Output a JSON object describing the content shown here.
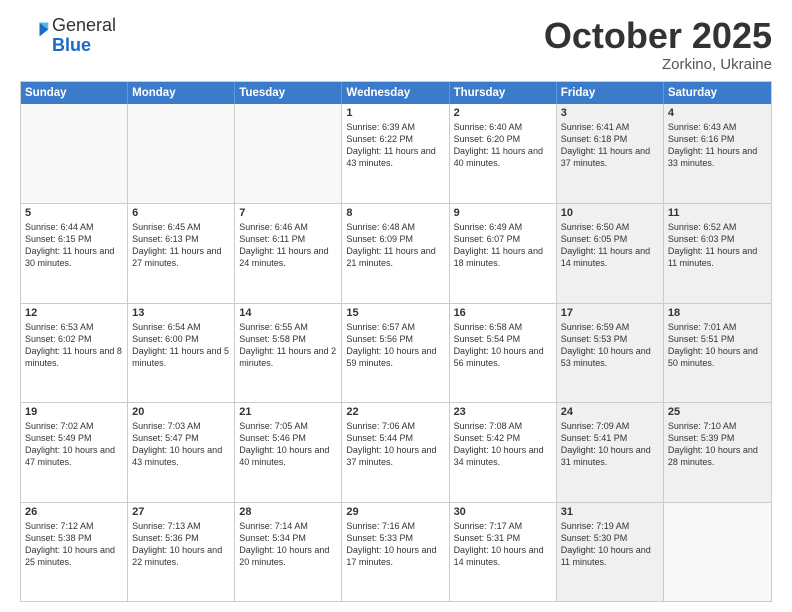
{
  "header": {
    "logo": {
      "general": "General",
      "blue": "Blue"
    },
    "month": "October 2025",
    "location": "Zorkino, Ukraine"
  },
  "weekdays": [
    "Sunday",
    "Monday",
    "Tuesday",
    "Wednesday",
    "Thursday",
    "Friday",
    "Saturday"
  ],
  "rows": [
    [
      {
        "day": "",
        "info": "",
        "bg": "empty"
      },
      {
        "day": "",
        "info": "",
        "bg": "empty"
      },
      {
        "day": "",
        "info": "",
        "bg": "empty"
      },
      {
        "day": "1",
        "info": "Sunrise: 6:39 AM\nSunset: 6:22 PM\nDaylight: 11 hours and 43 minutes.",
        "bg": ""
      },
      {
        "day": "2",
        "info": "Sunrise: 6:40 AM\nSunset: 6:20 PM\nDaylight: 11 hours and 40 minutes.",
        "bg": ""
      },
      {
        "day": "3",
        "info": "Sunrise: 6:41 AM\nSunset: 6:18 PM\nDaylight: 11 hours and 37 minutes.",
        "bg": "gray-bg"
      },
      {
        "day": "4",
        "info": "Sunrise: 6:43 AM\nSunset: 6:16 PM\nDaylight: 11 hours and 33 minutes.",
        "bg": "gray-bg"
      }
    ],
    [
      {
        "day": "5",
        "info": "Sunrise: 6:44 AM\nSunset: 6:15 PM\nDaylight: 11 hours and 30 minutes.",
        "bg": ""
      },
      {
        "day": "6",
        "info": "Sunrise: 6:45 AM\nSunset: 6:13 PM\nDaylight: 11 hours and 27 minutes.",
        "bg": ""
      },
      {
        "day": "7",
        "info": "Sunrise: 6:46 AM\nSunset: 6:11 PM\nDaylight: 11 hours and 24 minutes.",
        "bg": ""
      },
      {
        "day": "8",
        "info": "Sunrise: 6:48 AM\nSunset: 6:09 PM\nDaylight: 11 hours and 21 minutes.",
        "bg": ""
      },
      {
        "day": "9",
        "info": "Sunrise: 6:49 AM\nSunset: 6:07 PM\nDaylight: 11 hours and 18 minutes.",
        "bg": ""
      },
      {
        "day": "10",
        "info": "Sunrise: 6:50 AM\nSunset: 6:05 PM\nDaylight: 11 hours and 14 minutes.",
        "bg": "gray-bg"
      },
      {
        "day": "11",
        "info": "Sunrise: 6:52 AM\nSunset: 6:03 PM\nDaylight: 11 hours and 11 minutes.",
        "bg": "gray-bg"
      }
    ],
    [
      {
        "day": "12",
        "info": "Sunrise: 6:53 AM\nSunset: 6:02 PM\nDaylight: 11 hours and 8 minutes.",
        "bg": ""
      },
      {
        "day": "13",
        "info": "Sunrise: 6:54 AM\nSunset: 6:00 PM\nDaylight: 11 hours and 5 minutes.",
        "bg": ""
      },
      {
        "day": "14",
        "info": "Sunrise: 6:55 AM\nSunset: 5:58 PM\nDaylight: 11 hours and 2 minutes.",
        "bg": ""
      },
      {
        "day": "15",
        "info": "Sunrise: 6:57 AM\nSunset: 5:56 PM\nDaylight: 10 hours and 59 minutes.",
        "bg": ""
      },
      {
        "day": "16",
        "info": "Sunrise: 6:58 AM\nSunset: 5:54 PM\nDaylight: 10 hours and 56 minutes.",
        "bg": ""
      },
      {
        "day": "17",
        "info": "Sunrise: 6:59 AM\nSunset: 5:53 PM\nDaylight: 10 hours and 53 minutes.",
        "bg": "gray-bg"
      },
      {
        "day": "18",
        "info": "Sunrise: 7:01 AM\nSunset: 5:51 PM\nDaylight: 10 hours and 50 minutes.",
        "bg": "gray-bg"
      }
    ],
    [
      {
        "day": "19",
        "info": "Sunrise: 7:02 AM\nSunset: 5:49 PM\nDaylight: 10 hours and 47 minutes.",
        "bg": ""
      },
      {
        "day": "20",
        "info": "Sunrise: 7:03 AM\nSunset: 5:47 PM\nDaylight: 10 hours and 43 minutes.",
        "bg": ""
      },
      {
        "day": "21",
        "info": "Sunrise: 7:05 AM\nSunset: 5:46 PM\nDaylight: 10 hours and 40 minutes.",
        "bg": ""
      },
      {
        "day": "22",
        "info": "Sunrise: 7:06 AM\nSunset: 5:44 PM\nDaylight: 10 hours and 37 minutes.",
        "bg": ""
      },
      {
        "day": "23",
        "info": "Sunrise: 7:08 AM\nSunset: 5:42 PM\nDaylight: 10 hours and 34 minutes.",
        "bg": ""
      },
      {
        "day": "24",
        "info": "Sunrise: 7:09 AM\nSunset: 5:41 PM\nDaylight: 10 hours and 31 minutes.",
        "bg": "gray-bg"
      },
      {
        "day": "25",
        "info": "Sunrise: 7:10 AM\nSunset: 5:39 PM\nDaylight: 10 hours and 28 minutes.",
        "bg": "gray-bg"
      }
    ],
    [
      {
        "day": "26",
        "info": "Sunrise: 7:12 AM\nSunset: 5:38 PM\nDaylight: 10 hours and 25 minutes.",
        "bg": ""
      },
      {
        "day": "27",
        "info": "Sunrise: 7:13 AM\nSunset: 5:36 PM\nDaylight: 10 hours and 22 minutes.",
        "bg": ""
      },
      {
        "day": "28",
        "info": "Sunrise: 7:14 AM\nSunset: 5:34 PM\nDaylight: 10 hours and 20 minutes.",
        "bg": ""
      },
      {
        "day": "29",
        "info": "Sunrise: 7:16 AM\nSunset: 5:33 PM\nDaylight: 10 hours and 17 minutes.",
        "bg": ""
      },
      {
        "day": "30",
        "info": "Sunrise: 7:17 AM\nSunset: 5:31 PM\nDaylight: 10 hours and 14 minutes.",
        "bg": ""
      },
      {
        "day": "31",
        "info": "Sunrise: 7:19 AM\nSunset: 5:30 PM\nDaylight: 10 hours and 11 minutes.",
        "bg": "gray-bg"
      },
      {
        "day": "",
        "info": "",
        "bg": "empty"
      }
    ]
  ]
}
